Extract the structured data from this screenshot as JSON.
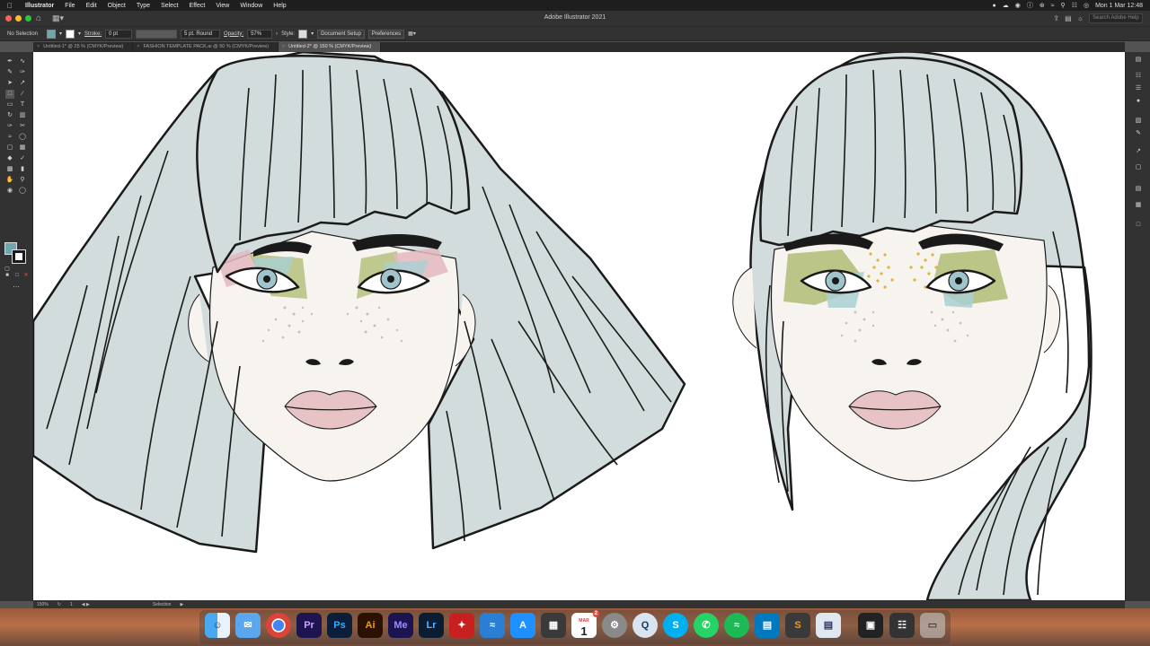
{
  "menubar": {
    "app_name": "Illustrator",
    "items": [
      "File",
      "Edit",
      "Object",
      "Type",
      "Select",
      "Effect",
      "View",
      "Window",
      "Help"
    ],
    "clock": "Mon 1 Mar 12:48"
  },
  "window": {
    "title": "Adobe Illustrator 2021",
    "search_placeholder": "Search Adobe Help"
  },
  "controlbar": {
    "selection": "No Selection",
    "fill_color": "#6fa6b0",
    "stroke_label": "Stroke:",
    "stroke_value": "0 pt",
    "brush_value": "5 pt. Round",
    "opacity_label": "Opacity:",
    "opacity_value": "57%",
    "style_label": "Style:",
    "document_setup": "Document Setup",
    "preferences": "Preferences"
  },
  "tabs": [
    {
      "label": "Untitled-1* @ 25 % (CMYK/Preview)",
      "active": false
    },
    {
      "label": "FASHION TEMPLATE PACK.ai @ 50 % (CMYK/Preview)",
      "active": false
    },
    {
      "label": "Untitled-2* @ 150 % (CMYK/Preview)",
      "active": true
    }
  ],
  "statusbar": {
    "zoom": "150%",
    "artboard": "1",
    "tool": "Selection"
  },
  "dock": {
    "calendar_month": "MAR",
    "calendar_day": "1",
    "calendar_badge": "2",
    "items": [
      "Finder",
      "Mail",
      "Chrome",
      "Premiere Pro",
      "Photoshop",
      "Illustrator",
      "Media Encoder",
      "Lightroom",
      "Acrobat",
      "Migration",
      "App Store",
      "Calculator",
      "Calendar",
      "System Preferences",
      "QuickTime",
      "Skype",
      "WhatsApp",
      "Spotify",
      "Trello",
      "Sublime Text",
      "Preview",
      "Screenshot",
      "Window",
      "Trash"
    ],
    "labels": {
      "premiere": "Pr",
      "photoshop": "Ps",
      "illustrator": "Ai",
      "media_encoder": "Me",
      "lightroom": "Lr"
    }
  },
  "colors": {
    "hair": "#d3dcdc",
    "skin": "#f7f3ef",
    "lips": "#e7c3c6",
    "shadow_green": "#b5c07c",
    "shadow_blue": "#a9cfd2",
    "shadow_pink": "#e3b8c0",
    "dots": "#e2b23f",
    "iris": "#9fc4cc"
  }
}
